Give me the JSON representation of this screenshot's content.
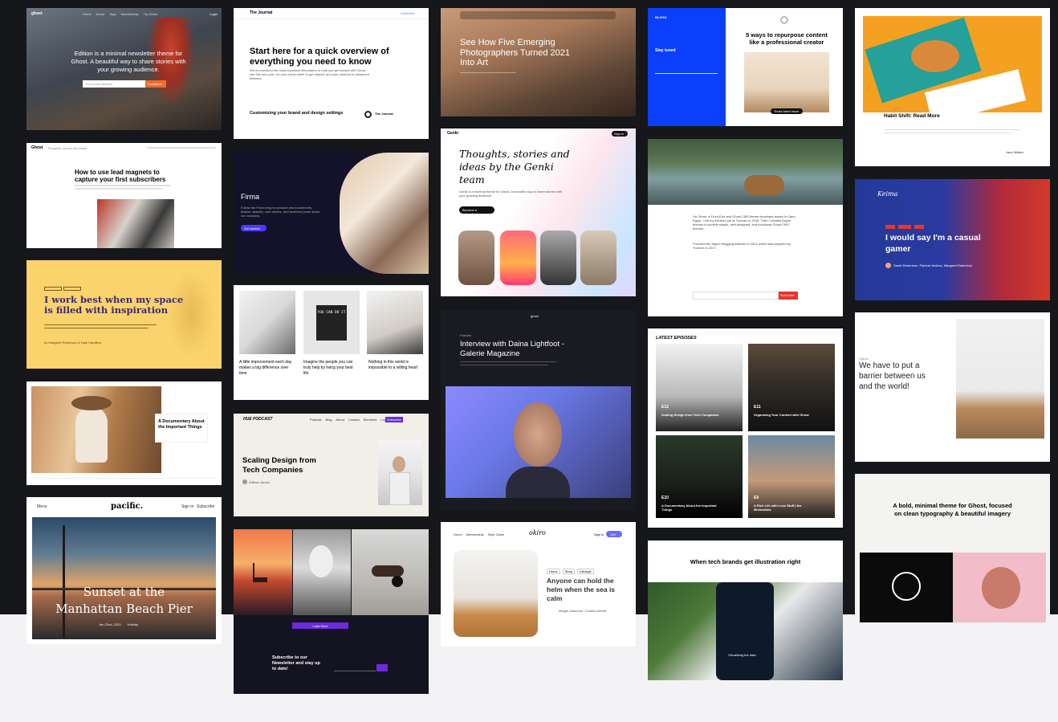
{
  "themes": {
    "edition": {
      "logo": "ghost",
      "nav": [
        "Home",
        "About",
        "Tags",
        "Membership",
        "Try Ghost"
      ],
      "login": "Login",
      "hero_text": "Edition is a minimal newsletter theme for Ghost. A beautiful way to share stories with your growing audience.",
      "email_placeholder": "Your email address",
      "subscribe": "Subscribe"
    },
    "journal": {
      "brand": "The Journal",
      "subscribe": "Subscribe",
      "headline": "Start here for a quick overview of everything you need to know",
      "body": "We've crammed the most important information to help you get started with Ghost into this one post. It's your cheat-sheet to get started, and your shortcut to advanced features.",
      "card_title": "Customizing your brand and design settings",
      "side_name": "The Journal"
    },
    "emerging": {
      "headline": "See How Five Emerging Photographers Turned 2021 Into Art"
    },
    "blue": {
      "brand": "BLOGG",
      "stay_tuned": "Stay tuned",
      "post_title": "5 ways to repurpose content like a professional creator",
      "read_more": "Read latest issue"
    },
    "habit": {
      "title": "Habit Shift: Read More",
      "author": "Jane Walker"
    },
    "ghostblog": {
      "logo": "Ghost",
      "tagline": "Thoughts, stories and ideas",
      "headline": "How to use lead magnets to capture your first subscribers"
    },
    "firma": {
      "brand": "Firma",
      "body": "Follow the Firma blog for product announcements, feature updates, user stories, and technical posts about our company.",
      "button": "Get started"
    },
    "genki": {
      "logo": "Genki",
      "headline": "Thoughts, stories and ideas by the Genki team",
      "body": "Genki is a minimal theme for Ghost. A beautiful way to share stories with your growing audience.",
      "button": "Become a subscriber",
      "signin": "Sign in"
    },
    "profile": {
      "para1": "I'm Ghost, a Front-End and Ghost CMS theme developer based in Cairo, Egypt. I left my full-time job at Truenex in 2018. Then I created Aspire themes to provide simple, well-designed, and functional Ghost CMS themes.",
      "para2": "Founded the Aspire blogging platform in 2021 which was acquired by Truenex in 2017.",
      "subscribe": "Subscribe"
    },
    "keima": {
      "logo": "Keima",
      "headline": "I would say I'm a casual gamer",
      "authors": "Sarah Robertson, Patricia Jenkins, Margaret Robertson"
    },
    "workbest": {
      "headline": "I work best when my space is filled with inspiration",
      "byline": "by Margaret Robertson & Dale Hamilton"
    },
    "cards3": {
      "items": [
        "A little improvement each day makes a big difference over time",
        "Imagine the people you can truly help by living your best life",
        "Nothing in this world is impossible to a willing heart"
      ],
      "letterboard": "YOU CAN DO IT"
    },
    "daina": {
      "logo": "ghost",
      "tag": "Fashion",
      "headline": "Interview with Daina Lightfoot - Galerie Magazine"
    },
    "podcast": {
      "section": "LATEST EPISODES",
      "episodes": [
        {
          "num": "E12",
          "title": "Scaling Design from Tech Companies"
        },
        {
          "num": "E11",
          "title": "Organizing Your Content with Ghost"
        },
        {
          "num": "E10",
          "title": "A Documentary About the Important Things"
        },
        {
          "num": "E9",
          "title": "A Rich Life with Less Stuff | the Minimalists"
        }
      ]
    },
    "barrier": {
      "tag": "Nature",
      "headline": "We have to put a barrier between us and the world!"
    },
    "documentary": {
      "title": "A Documentary About the Important Things"
    },
    "hue": {
      "logo": "HUE PODCAST",
      "nav": [
        "Podcast",
        "Blog",
        "About",
        "Contact",
        "Elements",
        "Log in"
      ],
      "cta": "Subscribe",
      "headline": "Scaling Design from Tech Companies",
      "author": "William James"
    },
    "bold": {
      "headline": "A bold, minimal theme for Ghost, focused on clean typography & beautiful imagery"
    },
    "pacific": {
      "menu": "Menu",
      "logo": "pacific.",
      "signin": "Sign in",
      "subscribe": "Subscribe",
      "headline": "Sunset at the Manhattan Beach Pier",
      "meta": "Jan 22nd, 2020",
      "tag": "Holiday"
    },
    "newsletter": {
      "button": "Load More",
      "heading": "Subscribe to our Newsletter and stay up to date!"
    },
    "okiro": {
      "logo": "okiro",
      "nav": [
        "Home",
        "Membership",
        "Style Guide"
      ],
      "signin": "Sign in",
      "join": "Join",
      "tags": [
        "Home",
        "Story",
        "Lifestyle"
      ],
      "headline": "Anyone can hold the helm when the sea is calm",
      "authors": "Megan Anderson, Charles Barrett"
    },
    "illustration": {
      "headline": "When tech brands get illustration right",
      "caption": "Visualising the data"
    }
  },
  "colors": {
    "dark_bg": "#15171a",
    "light_bg": "#f3f3f5",
    "blue": "#0a3ffb",
    "orange": "#f26b2a",
    "purple": "#6b2bd9",
    "red": "#e8362b",
    "yellow": "#fbd36c"
  }
}
